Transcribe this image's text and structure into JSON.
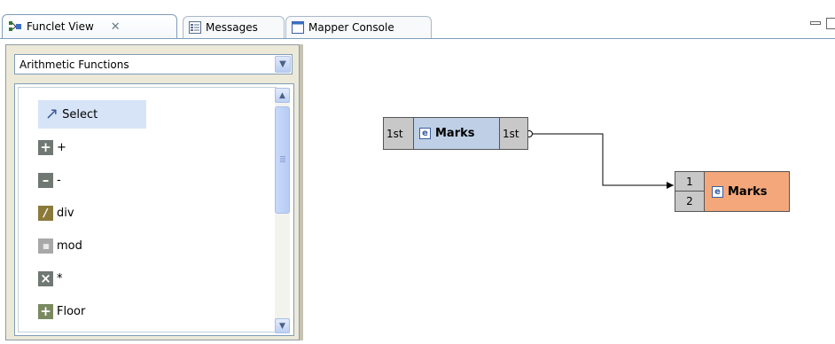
{
  "tabs": [
    {
      "label": "Funclet View",
      "close": "✕"
    },
    {
      "label": "Messages"
    },
    {
      "label": "Mapper Console"
    }
  ],
  "palette": {
    "category": "Arithmetic Functions",
    "items": [
      {
        "label": "Select",
        "icon": "cursor-arrow-icon"
      },
      {
        "label": "+",
        "icon": "plus-icon"
      },
      {
        "label": "-",
        "icon": "minus-icon"
      },
      {
        "label": "div",
        "icon": "div-icon"
      },
      {
        "label": "mod",
        "icon": "mod-icon"
      },
      {
        "label": "*",
        "icon": "multiply-icon"
      },
      {
        "label": "Floor",
        "icon": "floor-icon"
      }
    ]
  },
  "diagram": {
    "source_node": {
      "left_port": "1st",
      "name": "Marks",
      "right_port": "1st"
    },
    "target_node": {
      "ports": [
        "1",
        "2"
      ],
      "name": "Marks",
      "fill": "#f4a77a"
    }
  }
}
